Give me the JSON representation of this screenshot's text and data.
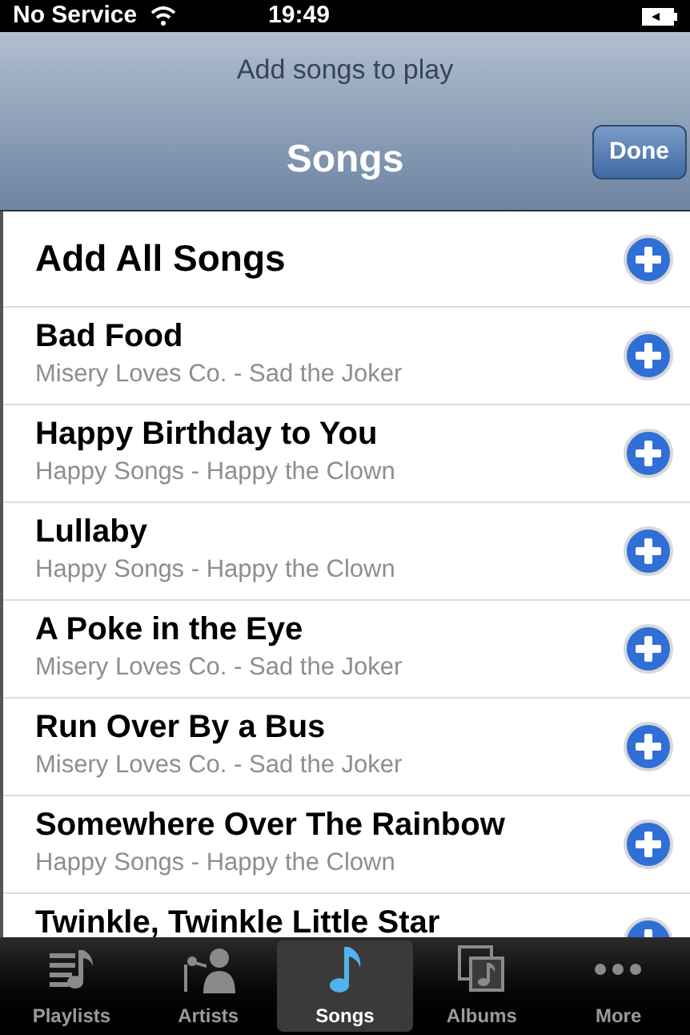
{
  "status_bar": {
    "carrier": "No Service",
    "time": "19:49"
  },
  "nav_bar": {
    "prompt": "Add songs to play",
    "title": "Songs",
    "done_button": "Done"
  },
  "add_all": {
    "label": "Add All Songs"
  },
  "songs": [
    {
      "title": "Bad Food",
      "subtitle": "Misery Loves Co. - Sad the Joker"
    },
    {
      "title": "Happy Birthday to You",
      "subtitle": "Happy Songs - Happy the Clown"
    },
    {
      "title": "Lullaby",
      "subtitle": "Happy Songs - Happy the Clown"
    },
    {
      "title": "A Poke in the Eye",
      "subtitle": "Misery Loves Co. - Sad the Joker"
    },
    {
      "title": "Run Over By a Bus",
      "subtitle": "Misery Loves Co. - Sad the Joker"
    },
    {
      "title": "Somewhere Over The Rainbow",
      "subtitle": "Happy Songs - Happy the Clown"
    },
    {
      "title": "Twinkle, Twinkle Little Star"
    }
  ],
  "tab_bar": [
    {
      "kind": "playlists",
      "label": "Playlists",
      "selected": false
    },
    {
      "kind": "artists",
      "label": "Artists",
      "selected": false
    },
    {
      "kind": "songs",
      "label": "Songs",
      "selected": true
    },
    {
      "kind": "albums",
      "label": "Albums",
      "selected": false
    },
    {
      "kind": "more",
      "label": "More",
      "selected": false
    }
  ]
}
